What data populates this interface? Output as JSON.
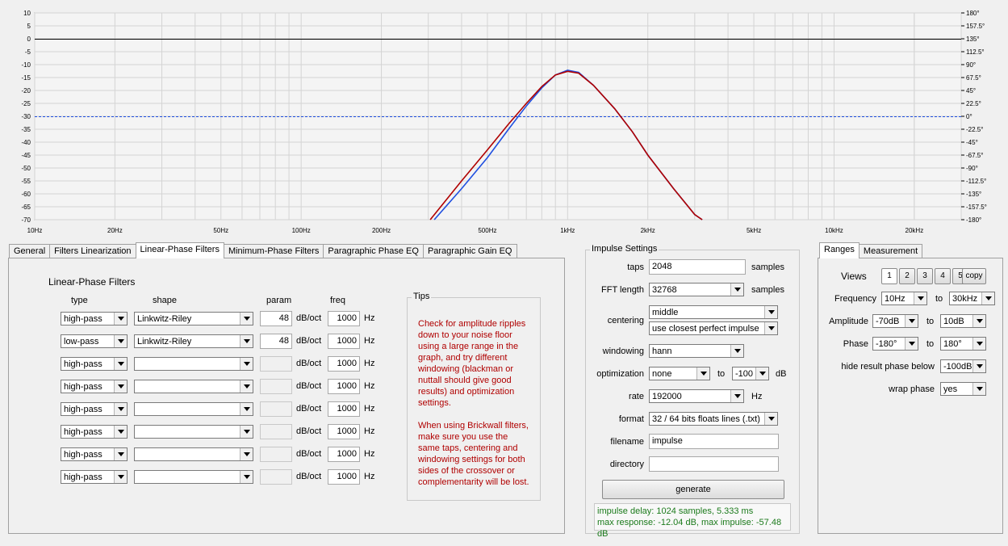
{
  "graph": {
    "y_ticks_left": [
      "10",
      "5",
      "0",
      "-5",
      "-10",
      "-15",
      "-20",
      "-25",
      "-30",
      "-35",
      "-40",
      "-45",
      "-50",
      "-55",
      "-60",
      "-65",
      "-70"
    ],
    "y_ticks_right": [
      "180°",
      "157.5°",
      "135°",
      "112.5°",
      "90°",
      "67.5°",
      "45°",
      "22.5°",
      "0°",
      "-22.5°",
      "-45°",
      "-67.5°",
      "-90°",
      "-112.5°",
      "-135°",
      "-157.5°",
      "-180°"
    ],
    "x_ticks": [
      {
        "f": 10,
        "label": "10Hz"
      },
      {
        "f": 20,
        "label": "20Hz"
      },
      {
        "f": 50,
        "label": "50Hz"
      },
      {
        "f": 100,
        "label": "100Hz"
      },
      {
        "f": 200,
        "label": "200Hz"
      },
      {
        "f": 500,
        "label": "500Hz"
      },
      {
        "f": 1000,
        "label": "1kHz"
      },
      {
        "f": 2000,
        "label": "2kHz"
      },
      {
        "f": 5000,
        "label": "5kHz"
      },
      {
        "f": 10000,
        "label": "10kHz"
      },
      {
        "f": 20000,
        "label": "20kHz"
      }
    ],
    "colors": {
      "blue": "#1f4fe0",
      "red": "#b00000",
      "grid": "#d4d4d4"
    }
  },
  "chart_data": {
    "type": "line",
    "xlabel": "",
    "ylabel": "",
    "x_scale": "log",
    "xlim": [
      10,
      30000
    ],
    "ylim": [
      -70,
      10
    ],
    "y2lim": [
      -180,
      180
    ],
    "grid": true,
    "reference_lines": [
      {
        "y": 0,
        "color": "#000000"
      },
      {
        "y": -30,
        "color": "#1f4fe0",
        "style": "dashed"
      }
    ],
    "series": [
      {
        "color": "#1f4fe0",
        "x": [
          316,
          400,
          500,
          600,
          700,
          800,
          900,
          1000,
          1100,
          1250,
          1500,
          1750,
          2000,
          2500,
          3000,
          3200
        ],
        "y": [
          -70,
          -58,
          -46,
          -35,
          -26,
          -19,
          -14,
          -12.2,
          -13,
          -18,
          -27,
          -36,
          -45,
          -58,
          -68,
          -70
        ]
      },
      {
        "color": "#b00000",
        "x": [
          305,
          400,
          500,
          600,
          700,
          800,
          900,
          1000,
          1100,
          1250,
          1500,
          1750,
          2000,
          2500,
          3000,
          3200
        ],
        "y": [
          -70,
          -55,
          -43,
          -33,
          -25,
          -18.5,
          -14,
          -12.6,
          -13.3,
          -18,
          -27,
          -36,
          -45,
          -58,
          -68,
          -70
        ]
      }
    ]
  },
  "left_tabs": [
    {
      "label": "General"
    },
    {
      "label": "Filters Linearization"
    },
    {
      "label": "Linear-Phase Filters"
    },
    {
      "label": "Minimum-Phase Filters"
    },
    {
      "label": "Paragraphic Phase EQ"
    },
    {
      "label": "Paragraphic Gain EQ"
    }
  ],
  "filters": {
    "title": "Linear-Phase Filters",
    "headers": {
      "type": "type",
      "shape": "shape",
      "param": "param",
      "freq": "freq"
    },
    "unit_param": "dB/oct",
    "unit_freq": "Hz",
    "rows": [
      {
        "type": "high-pass",
        "shape": "Linkwitz-Riley",
        "param": "48",
        "freq": "1000"
      },
      {
        "type": "low-pass",
        "shape": "Linkwitz-Riley",
        "param": "48",
        "freq": "1000"
      },
      {
        "type": "high-pass",
        "shape": "",
        "param": "",
        "freq": "1000"
      },
      {
        "type": "high-pass",
        "shape": "",
        "param": "",
        "freq": "1000"
      },
      {
        "type": "high-pass",
        "shape": "",
        "param": "",
        "freq": "1000"
      },
      {
        "type": "high-pass",
        "shape": "",
        "param": "",
        "freq": "1000"
      },
      {
        "type": "high-pass",
        "shape": "",
        "param": "",
        "freq": "1000"
      },
      {
        "type": "high-pass",
        "shape": "",
        "param": "",
        "freq": "1000"
      }
    ]
  },
  "tips": {
    "title": "Tips",
    "text1": "Check for amplitude ripples\ndown to your noise floor\nusing a large range in the\ngraph, and try different\nwindowing (blackman or\nnuttall should give good\nresults) and optimization\nsettings.",
    "text2": "When using Brickwall filters,\nmake sure you use the\nsame taps, centering and\nwindowing settings for both\nsides of the crossover or\ncomplementarity will be lost."
  },
  "impulse": {
    "title": "Impulse Settings",
    "taps_label": "taps",
    "taps": "2048",
    "taps_unit": "samples",
    "fft_label": "FFT length",
    "fft": "32768",
    "fft_unit": "samples",
    "centering_label": "centering",
    "centering": "middle",
    "centering2": "use closest perfect impulse",
    "windowing_label": "windowing",
    "windowing": "hann",
    "optimization_label": "optimization",
    "optimization": "none",
    "opt_to": "to",
    "opt_db": "-100",
    "opt_unit": "dB",
    "rate_label": "rate",
    "rate": "192000",
    "rate_unit": "Hz",
    "format_label": "format",
    "format": "32 / 64 bits floats lines (.txt)",
    "filename_label": "filename",
    "filename": "impulse",
    "directory_label": "directory",
    "directory": "",
    "generate": "generate",
    "status1": "impulse delay: 1024 samples, 5.333 ms",
    "status2": "max response: -12.04 dB, max impulse: -57.48 dB"
  },
  "right_tabs": [
    {
      "label": "Ranges"
    },
    {
      "label": "Measurement"
    }
  ],
  "ranges": {
    "views_label": "Views",
    "views": [
      "1",
      "2",
      "3",
      "4",
      "5"
    ],
    "copy": "copy",
    "to": "to",
    "frequency_label": "Frequency",
    "freq_from": "10Hz",
    "freq_to": "30kHz",
    "amplitude_label": "Amplitude",
    "amp_from": "-70dB",
    "amp_to": "10dB",
    "phase_label": "Phase",
    "phase_from": "-180°",
    "phase_to": "180°",
    "hide_label": "hide result phase below",
    "hide": "-100dB",
    "wrap_label": "wrap phase",
    "wrap": "yes"
  }
}
